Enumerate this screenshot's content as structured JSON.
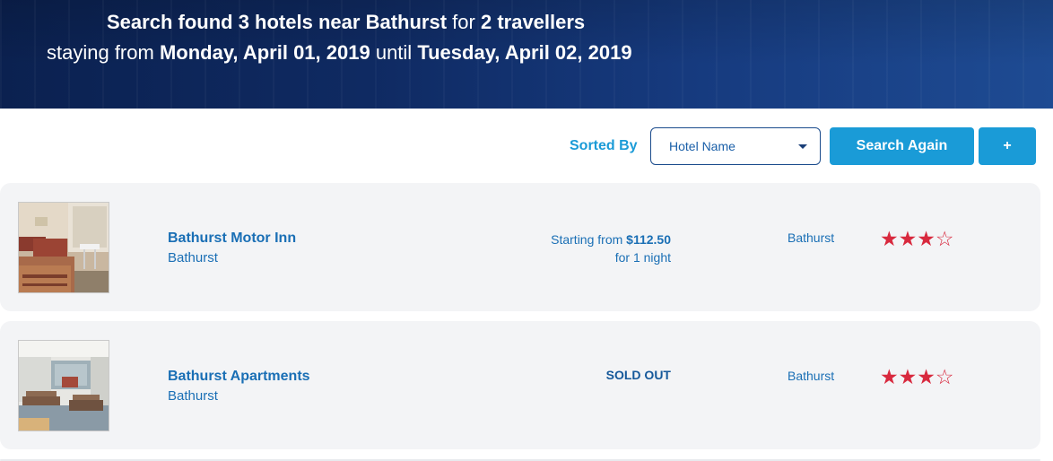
{
  "header": {
    "search_found": "Search found",
    "hotel_count": "3 hotels",
    "near_word": "near",
    "location": "Bathurst",
    "for_word": "for",
    "travellers": "2 travellers",
    "staying_from": "staying from",
    "check_in": "Monday, April 01, 2019",
    "until_word": "until",
    "check_out": "Tuesday, April 02, 2019"
  },
  "controls": {
    "sort_label": "Sorted By",
    "sort_value": "Hotel Name",
    "search_again_label": "Search Again",
    "add_label": "+"
  },
  "hotels": [
    {
      "name": "Bathurst Motor Inn",
      "city": "Bathurst",
      "price_prefix": "Starting from",
      "price": "$112.50",
      "price_suffix": "for 1 night",
      "sold_out": "",
      "location": "Bathurst",
      "rating": 3,
      "max_rating": 4
    },
    {
      "name": "Bathurst Apartments",
      "city": "Bathurst",
      "price_prefix": "",
      "price": "",
      "price_suffix": "",
      "sold_out": "SOLD OUT",
      "location": "Bathurst",
      "rating": 3,
      "max_rating": 4
    }
  ],
  "colors": {
    "accent": "#1a9bd7",
    "link": "#1a6fb5",
    "star": "#d8293e",
    "hero_dark": "#0b2150"
  }
}
